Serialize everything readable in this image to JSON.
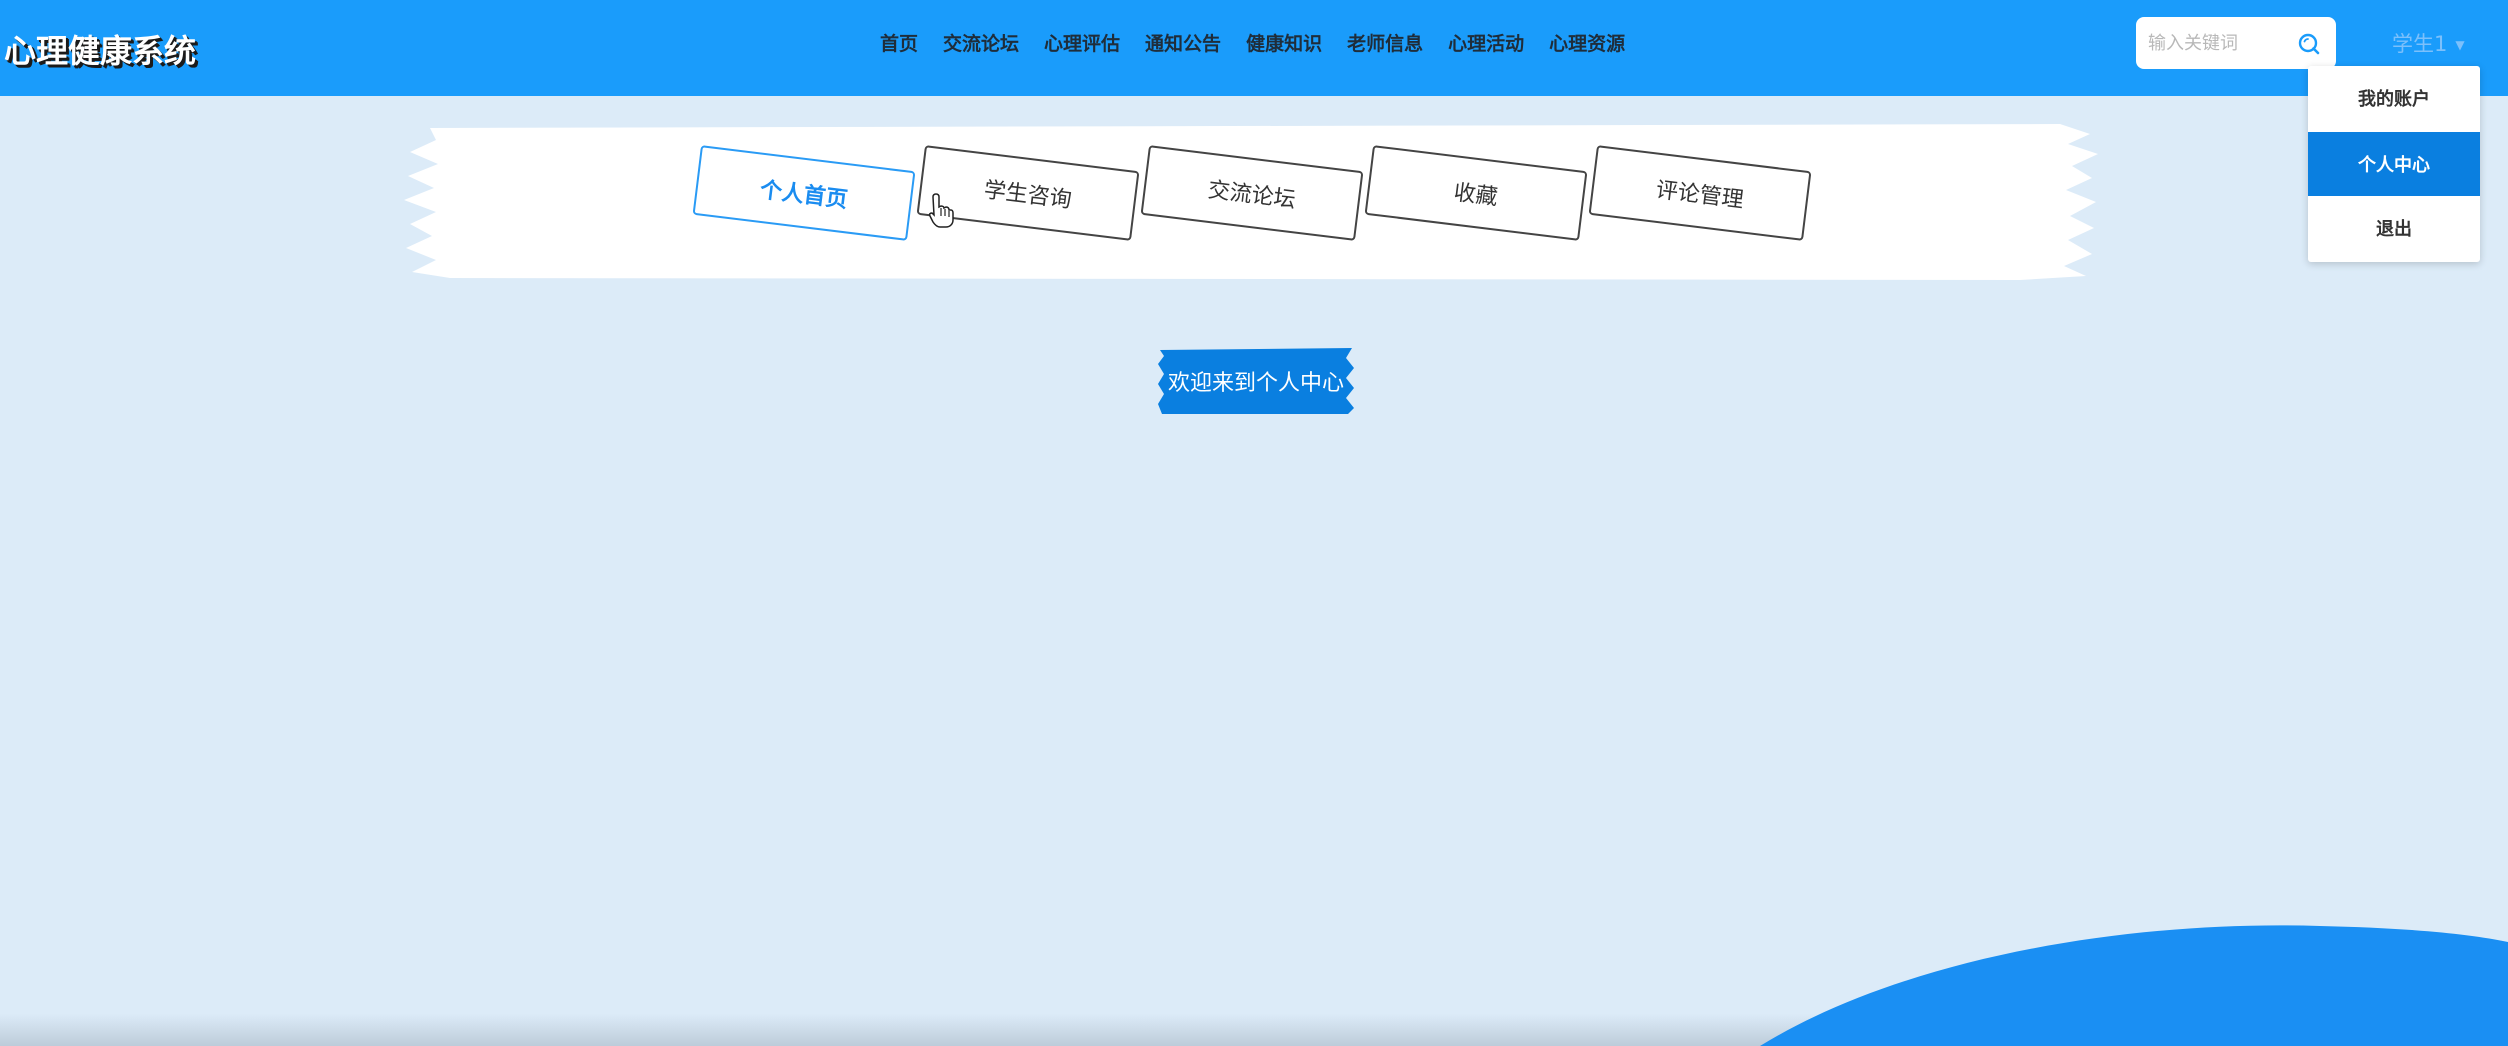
{
  "header": {
    "logo": "心理健康系统",
    "nav": [
      "首页",
      "交流论坛",
      "心理评估",
      "通知公告",
      "健康知识",
      "老师信息",
      "心理活动",
      "心理资源"
    ],
    "search": {
      "placeholder": "输入关键词"
    },
    "user": {
      "name": "学生1"
    }
  },
  "dropdown": {
    "items": [
      "我的账户",
      "个人中心",
      "退出"
    ],
    "active": "个人中心"
  },
  "tabs": {
    "items": [
      "个人首页",
      "学生咨询",
      "交流论坛",
      "收藏",
      "评论管理"
    ],
    "active": "个人首页"
  },
  "main": {
    "welcome": "欢迎来到个人中心"
  },
  "colors": {
    "header": "#1a9cfb",
    "background": "#dcebf8",
    "accent": "#0a7fe0",
    "active_tab_border": "#2a9bf5"
  },
  "icons": [
    "search-icon",
    "caret-down-icon",
    "hand-cursor-icon"
  ]
}
